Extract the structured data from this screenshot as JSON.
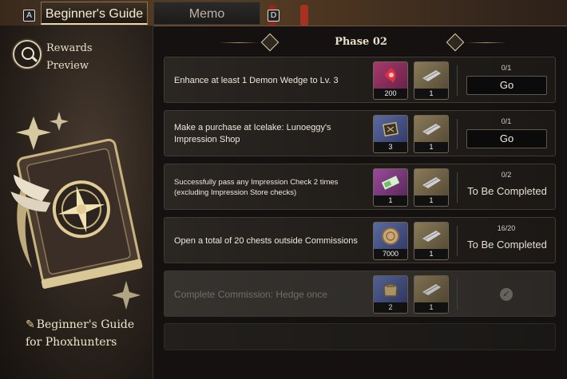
{
  "tabs": {
    "key_left": "A",
    "key_right": "D",
    "items": [
      {
        "label": "Beginner's Guide",
        "active": true
      },
      {
        "label": "Memo",
        "active": false
      }
    ]
  },
  "left_panel": {
    "rewards_line1": "Rewards",
    "rewards_line2": "Preview",
    "guide_line1": "Beginner's Guide",
    "guide_line2": "for Phoxhunters"
  },
  "phase": {
    "title": "Phase 02"
  },
  "tasks": [
    {
      "text": "Enhance at least 1 Demon Wedge to Lv. 3",
      "progress": "0/1",
      "action": "Go",
      "state": "go",
      "rewards": [
        {
          "icon": "demon-wedge-icon",
          "qty": "200"
        },
        {
          "icon": "quill-token-icon",
          "qty": "1"
        }
      ]
    },
    {
      "text": "Make a purchase at Icelake: Lunoeggy's Impression Shop",
      "progress": "0/1",
      "action": "Go",
      "state": "go",
      "rewards": [
        {
          "icon": "crate-icon",
          "qty": "3"
        },
        {
          "icon": "quill-token-icon",
          "qty": "1"
        }
      ]
    },
    {
      "text": "Successfully pass any Impression Check 2 times (excluding Impression Store checks)",
      "progress": "0/2",
      "action": "To Be Completed",
      "state": "pending",
      "rewards": [
        {
          "icon": "ticket-icon",
          "qty": "1"
        },
        {
          "icon": "quill-token-icon",
          "qty": "1"
        }
      ]
    },
    {
      "text": "Open a total of 20 chests outside Commissions",
      "progress": "16/20",
      "action": "To Be Completed",
      "state": "pending",
      "rewards": [
        {
          "icon": "coin-icon",
          "qty": "7000"
        },
        {
          "icon": "quill-token-icon",
          "qty": "1"
        }
      ]
    },
    {
      "text": "Complete Commission: Hedge once",
      "progress": "",
      "action": "",
      "state": "done",
      "rewards": [
        {
          "icon": "pouch-icon",
          "qty": "2"
        },
        {
          "icon": "quill-token-icon",
          "qty": "1"
        }
      ]
    }
  ],
  "colors": {
    "accent": "#e8d8b0",
    "panel": "#1f1c19",
    "done": "#3a3733"
  }
}
